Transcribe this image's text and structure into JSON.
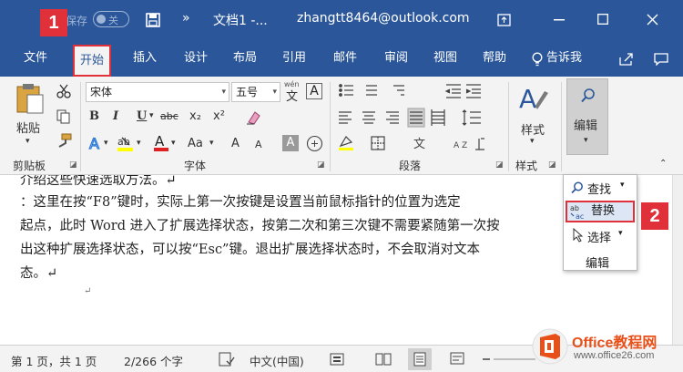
{
  "titlebar": {
    "autosave_label": "保存",
    "toggle_state": "关",
    "doc_title": "文档1 -...",
    "account": "zhangtt8464@outlook.com",
    "more_glyph": "»"
  },
  "tabs": [
    {
      "label": "文件"
    },
    {
      "label": "开始"
    },
    {
      "label": "插入"
    },
    {
      "label": "设计"
    },
    {
      "label": "布局"
    },
    {
      "label": "引用"
    },
    {
      "label": "邮件"
    },
    {
      "label": "审阅"
    },
    {
      "label": "视图"
    },
    {
      "label": "帮助"
    },
    {
      "label": "告诉我"
    }
  ],
  "ribbon": {
    "clipboard": {
      "paste": "粘贴",
      "label": "剪贴板"
    },
    "font": {
      "name": "宋体",
      "size": "五号",
      "wen": "wén",
      "bold": "B",
      "italic": "I",
      "underline": "U",
      "strike": "abc",
      "sub": "x₂",
      "sup": "x²",
      "grow": "A",
      "shrink": "A",
      "aa": "Aa",
      "label": "字体"
    },
    "paragraph": {
      "label": "段落"
    },
    "styles": {
      "label": "样式",
      "group_label": "样式"
    },
    "editing": {
      "label": "编辑"
    }
  },
  "document": {
    "lines": [
      "介绍这些快速选取方法。↵",
      "    ：这里在按“F8”键时，实际上第一次按键是设置当前鼠标指针的位置为选定",
      "起点，此时 Word 进入了扩展选择状态，按第二次和第三次键不需要紧随第一次按",
      "出这种扩展选择状态，可以按“Esc”键。退出扩展选择状态时，不会取消对文本",
      "态。↵",
      "↵"
    ]
  },
  "popup": {
    "find": "查找",
    "replace": "替换",
    "select": "选择",
    "footer": "编辑"
  },
  "status": {
    "page": "第 1 页，共 1 页",
    "words": "2/266 个字",
    "lang": "中文(中国)"
  },
  "badges": {
    "one": "1",
    "two": "2"
  },
  "watermark": {
    "brand": "Office教程网",
    "url": "www.office26.com"
  },
  "colors": {
    "word_blue": "#2b579a",
    "highlight_red": "#e0303a",
    "font_color_red": "#e02020",
    "highlight_yellow": "#ffff00"
  }
}
